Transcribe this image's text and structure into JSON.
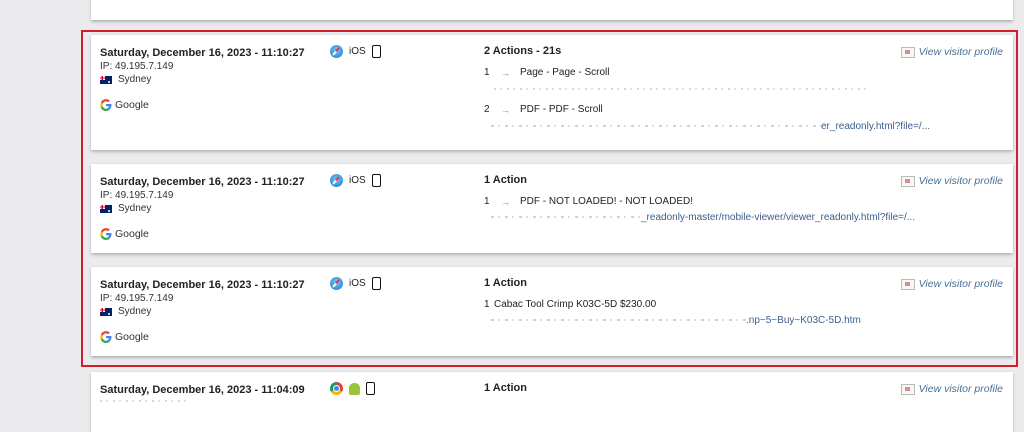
{
  "visits": [
    {
      "date": "Saturday, December 16, 2023 - 11:10:27",
      "ip": "IP: 49.195.7.149",
      "city": "Sydney",
      "referrer": "Google",
      "os": "iOS",
      "browser_icon": "safari-icon",
      "device_icon": "mobile-phone-icon",
      "actions_title": "2 Actions - 21s",
      "profile_link": "View visitor profile",
      "actions": [
        {
          "num": "1",
          "arrow": "→",
          "label": "Page - Page - Scroll",
          "url": ""
        },
        {
          "num": "2",
          "arrow": "→",
          "label": "PDF - PDF - Scroll",
          "url": "er_readonly.html?file=/..."
        }
      ]
    },
    {
      "date": "Saturday, December 16, 2023 - 11:10:27",
      "ip": "IP: 49.195.7.149",
      "city": "Sydney",
      "referrer": "Google",
      "os": "iOS",
      "browser_icon": "safari-icon",
      "device_icon": "mobile-phone-icon",
      "actions_title": "1 Action",
      "profile_link": "View visitor profile",
      "actions": [
        {
          "num": "1",
          "arrow": "→",
          "label": "PDF - NOT LOADED! - NOT LOADED!",
          "url": "_readonly-master/mobile-viewer/viewer_readonly.html?file=/..."
        }
      ]
    },
    {
      "date": "Saturday, December 16, 2023 - 11:10:27",
      "ip": "IP: 49.195.7.149",
      "city": "Sydney",
      "referrer": "Google",
      "os": "iOS",
      "browser_icon": "safari-icon",
      "device_icon": "mobile-phone-icon",
      "actions_title": "1 Action",
      "profile_link": "View visitor profile",
      "actions": [
        {
          "num": "1",
          "arrow": "",
          "label": "Cabac Tool Crimp K03C-5D $230.00",
          "url": ".np~5~Buy~K03C-5D.htm"
        }
      ]
    },
    {
      "date": "Saturday, December 16, 2023 - 11:04:09",
      "browser_icon": "chrome-icon",
      "os_icon": "android-icon",
      "device_icon": "mobile-phone-icon",
      "actions_title": "1 Action",
      "profile_link": "View visitor profile"
    }
  ],
  "colors": {
    "highlight_border": "#cf1f2a",
    "link": "#3b5e8c",
    "background": "#ebebed"
  }
}
